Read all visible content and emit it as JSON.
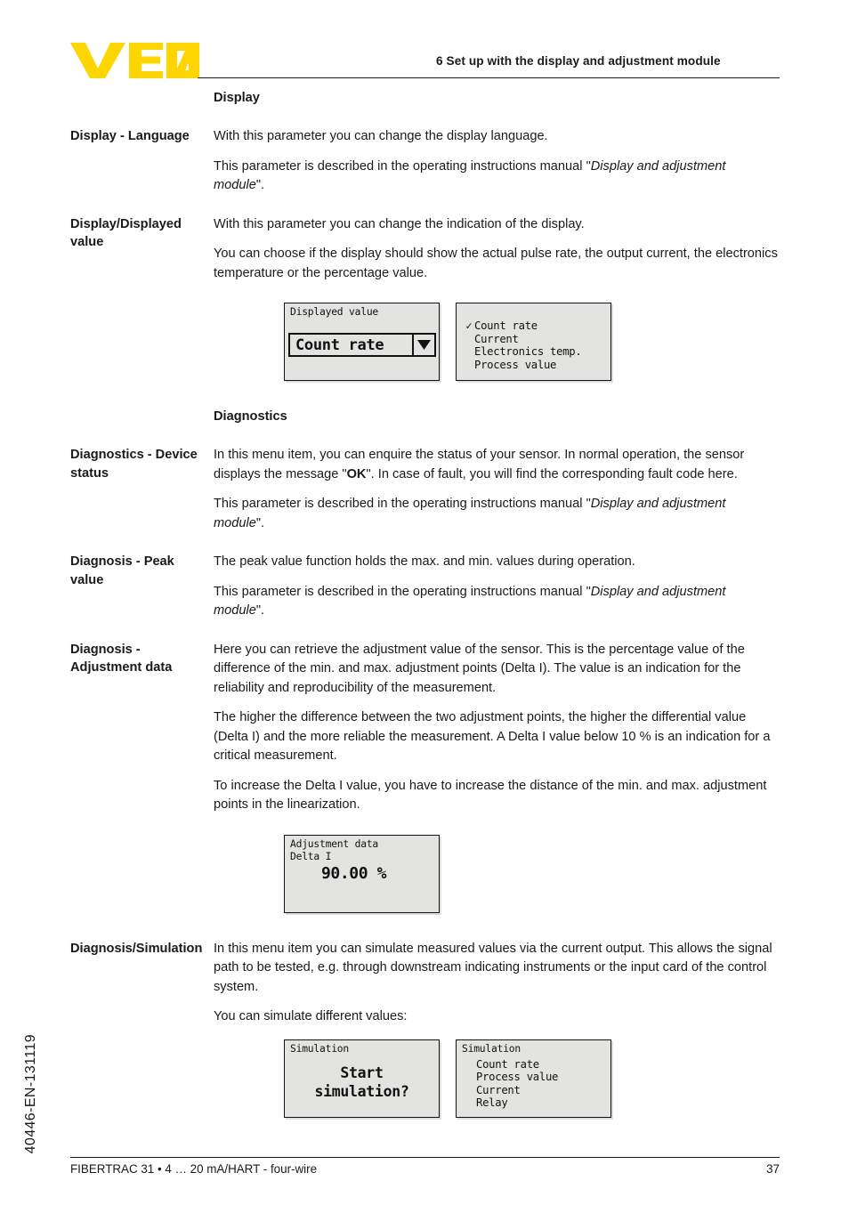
{
  "header": {
    "logo_text": "VEGA",
    "logo_color": "#FFD500",
    "chapter_title": "6 Set up with the display and adjustment module"
  },
  "doc_code": "40446-EN-131119",
  "sections": [
    {
      "id": "display-heading",
      "type": "heading",
      "label": "",
      "heading": "Display"
    },
    {
      "id": "display-language",
      "type": "text",
      "label": "Display - Language",
      "paragraphs": [
        {
          "text": "With this parameter you can change the display language."
        },
        {
          "pre": "This parameter is described in the operating instructions manual \"",
          "italic": "Display and adjustment module",
          "post": "\"."
        }
      ]
    },
    {
      "id": "display-displayed-value",
      "type": "text",
      "label": "Display/Displayed value",
      "paragraphs": [
        {
          "text": "With this parameter you can change the indication of the display."
        },
        {
          "text": "You can choose if the display should show the actual pulse rate, the output current, the electronics temperature or the percentage value."
        }
      ]
    },
    {
      "id": "diagnostics-heading",
      "type": "heading",
      "label": "",
      "heading": "Diagnostics"
    },
    {
      "id": "diagnostics-device-status",
      "type": "text",
      "label": "Diagnostics - Device status",
      "paragraphs": [
        {
          "pre": "In this menu item, you can enquire the status of your sensor. In normal operation, the sensor displays the message \"",
          "bold": "OK",
          "post": "\". In case of fault, you will find the corresponding fault code here."
        },
        {
          "pre": "This parameter is described in the operating instructions manual \"",
          "italic": "Display and adjustment module",
          "post": "\"."
        }
      ]
    },
    {
      "id": "diagnosis-peak-value",
      "type": "text",
      "label": "Diagnosis - Peak value",
      "paragraphs": [
        {
          "text": "The peak value function holds the max. and min. values during operation."
        },
        {
          "pre": "This parameter is described in the operating instructions manual \"",
          "italic": "Display and adjustment module",
          "post": "\"."
        }
      ]
    },
    {
      "id": "diagnosis-adjustment-data",
      "type": "text",
      "label": "Diagnosis - Adjustment data",
      "paragraphs": [
        {
          "text": "Here you can retrieve the adjustment value of the sensor. This is the percentage value of the difference of the min. and max. adjustment points (Delta I). The value is an indication for the reliability and reproducibility of the measurement."
        },
        {
          "text": "The higher the difference between the two adjustment points, the higher the differential value (Delta I) and the more reliable the measurement. A Delta I value below 10 % is an indication for a critical measurement."
        },
        {
          "text": "To increase the Delta I value, you have to increase the distance of the min. and max. adjustment points in the linearization."
        }
      ]
    },
    {
      "id": "diagnosis-simulation",
      "type": "text",
      "label": "Diagnosis/Simulation",
      "paragraphs": [
        {
          "text": "In this menu item you can simulate measured values via the current output. This allows the signal path to be tested, e.g. through downstream indicating instruments or the input card of the control system."
        },
        {
          "text": "You can simulate different values:"
        }
      ]
    }
  ],
  "figures": {
    "displayed_value": {
      "screen1": {
        "title": "Displayed value",
        "field_value": "Count rate",
        "dropdown_icon": "chevron-down-icon"
      },
      "screen2": {
        "title": "",
        "check_glyph": "✓",
        "items": [
          {
            "label": "Count rate",
            "selected": true,
            "checked": true
          },
          {
            "label": "Current",
            "selected": false,
            "checked": false
          },
          {
            "label": "Electronics temp.",
            "selected": false,
            "checked": false
          },
          {
            "label": "Process value",
            "selected": false,
            "checked": false
          }
        ]
      }
    },
    "adjustment_data": {
      "title": "Adjustment data",
      "subtitle": "Delta I",
      "value": "90.00 %"
    },
    "simulation": {
      "screen1": {
        "title": "Simulation",
        "line1": "Start",
        "line2": "simulation?"
      },
      "screen2": {
        "title": "Simulation",
        "items": [
          {
            "label": "Count rate",
            "selected": true
          },
          {
            "label": "Process value",
            "selected": false
          },
          {
            "label": "Current",
            "selected": false
          },
          {
            "label": "Relay",
            "selected": false
          }
        ]
      }
    }
  },
  "footer": {
    "left": "FIBERTRAC 31 • 4 … 20 mA/HART - four-wire",
    "page": "37"
  }
}
